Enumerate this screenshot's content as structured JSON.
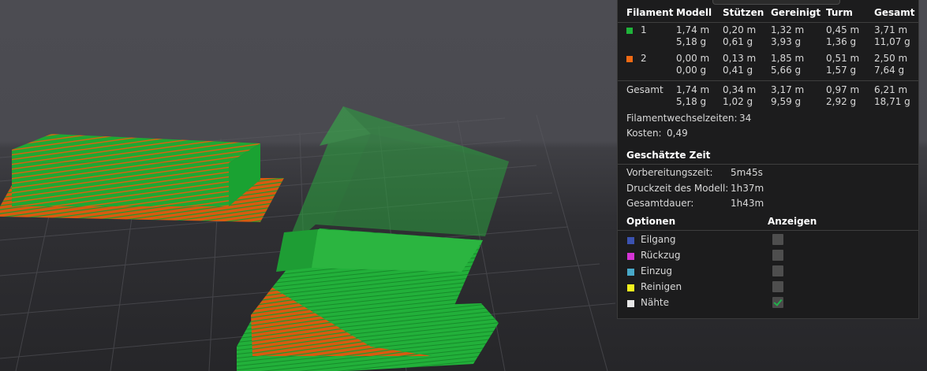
{
  "colors": {
    "filament1": "#1fb33a",
    "filament2": "#f06a14",
    "travel": "#3b52b0",
    "retract": "#d534d5",
    "unretract": "#48a8c8",
    "wipe": "#f2f21e",
    "seams": "#e8e8e8"
  },
  "stats": {
    "headers": [
      "Filament",
      "Modell",
      "Stützen",
      "Gereinigt",
      "Turm",
      "Gesamt"
    ],
    "rows": [
      {
        "id": "1",
        "color": "#1fb33a",
        "line1": [
          "1,74 m",
          "0,20 m",
          "1,32 m",
          "0,45 m",
          "3,71 m"
        ],
        "line2": [
          "5,18 g",
          "0,61 g",
          "3,93 g",
          "1,36 g",
          "11,07 g"
        ]
      },
      {
        "id": "2",
        "color": "#f06a14",
        "line1": [
          "0,00 m",
          "0,13 m",
          "1,85 m",
          "0,51 m",
          "2,50 m"
        ],
        "line2": [
          "0,00 g",
          "0,41 g",
          "5,66 g",
          "1,57 g",
          "7,64 g"
        ]
      }
    ],
    "total": {
      "label": "Gesamt",
      "line1": [
        "1,74 m",
        "0,34 m",
        "3,17 m",
        "0,97 m",
        "6,21 m"
      ],
      "line2": [
        "5,18 g",
        "1,02 g",
        "9,59 g",
        "2,92 g",
        "18,71 g"
      ]
    },
    "filament_changes_label": "Filamentwechselzeiten:",
    "filament_changes_value": "34",
    "cost_label": "Kosten:",
    "cost_value": "0,49"
  },
  "time": {
    "heading": "Geschätzte Zeit",
    "prep_label": "Vorbereitungszeit:",
    "prep_value": "5m45s",
    "print_label": "Druckzeit des Modell:",
    "print_value": "1h37m",
    "total_label": "Gesamtdauer:",
    "total_value": "1h43m"
  },
  "options": {
    "header_options": "Optionen",
    "header_show": "Anzeigen",
    "items": [
      {
        "label": "Eilgang",
        "color": "#3b52b0",
        "checked": false
      },
      {
        "label": "Rückzug",
        "color": "#d534d5",
        "checked": false
      },
      {
        "label": "Einzug",
        "color": "#48a8c8",
        "checked": false
      },
      {
        "label": "Reinigen",
        "color": "#f2f21e",
        "checked": false
      },
      {
        "label": "Nähte",
        "color": "#e8e8e8",
        "checked": true
      }
    ]
  }
}
